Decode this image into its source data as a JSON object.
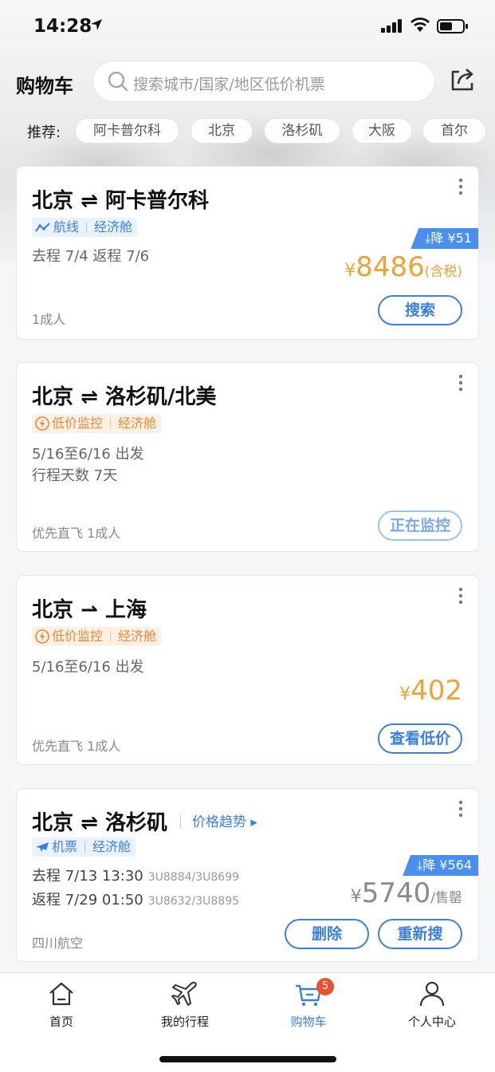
{
  "status": {
    "time": "14:28"
  },
  "header": {
    "title": "购物车",
    "search_placeholder": "搜索城市/国家/地区低价机票"
  },
  "recommend": {
    "label": "推荐:",
    "chips": [
      "阿卡普尔科",
      "北京",
      "洛杉矶",
      "大阪",
      "首尔"
    ]
  },
  "cards": [
    {
      "from": "北京",
      "arrow": "⇌",
      "to": "阿卡普尔科",
      "tag_main": "航线",
      "tag_class": "经济舱",
      "line1": "去程 7/4 返程 7/6",
      "drop": "降 ¥51",
      "price_yen": "¥",
      "price": "8486",
      "price_suffix": "(含税)",
      "foot": "1成人",
      "button": "搜索"
    },
    {
      "from": "北京",
      "arrow": "⇌",
      "to": "洛杉矶/北美",
      "tag_main": "低价监控",
      "tag_class": "经济舱",
      "line1": "5/16至6/16 出发",
      "line2": "行程天数 7天",
      "foot": "优先直飞 1成人",
      "button": "正在监控"
    },
    {
      "from": "北京",
      "arrow": "⇀",
      "to": "上海",
      "tag_main": "低价监控",
      "tag_class": "经济舱",
      "line1": "5/16至6/16 出发",
      "price_yen": "¥",
      "price": "402",
      "foot": "优先直飞 1成人",
      "button": "查看低价"
    },
    {
      "from": "北京",
      "arrow": "⇌",
      "to": "洛杉矶",
      "trend": "价格趋势 ▸",
      "tag_main": "机票",
      "tag_class": "经济舱",
      "go_label": "去程",
      "go_time": "7/13 13:30",
      "go_code": "3U8884/3U8699",
      "back_label": "返程",
      "back_time": "7/29 01:50",
      "back_code": "3U8632/3U8895",
      "drop": "降 ¥564",
      "price_yen": "¥",
      "price": "5740",
      "price_suffix": "/售罄",
      "foot": "四川航空",
      "button_delete": "删除",
      "button": "重新搜"
    }
  ],
  "tabbar": {
    "items": [
      {
        "label": "首页",
        "icon": "home-icon"
      },
      {
        "label": "我的行程",
        "icon": "plane-icon"
      },
      {
        "label": "购物车",
        "icon": "cart-icon",
        "badge": "5"
      },
      {
        "label": "个人中心",
        "icon": "person-icon"
      }
    ]
  },
  "colors": {
    "accent": "#3c7fe0",
    "price": "#eea23a",
    "monitor": "#e88a38",
    "badge": "#e8502e"
  }
}
